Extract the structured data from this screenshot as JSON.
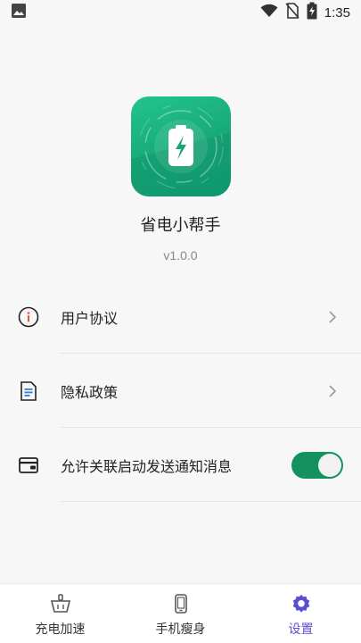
{
  "status_bar": {
    "time": "1:35",
    "icons": [
      "image-icon",
      "wifi-icon",
      "no-sim-icon",
      "battery-charging-icon"
    ]
  },
  "app": {
    "name": "省电小帮手",
    "version": "v1.0.0",
    "icon": "battery-bolt-icon"
  },
  "settings": {
    "items": [
      {
        "label": "用户协议",
        "icon": "info-circle-icon",
        "type": "link"
      },
      {
        "label": "隐私政策",
        "icon": "document-icon",
        "type": "link"
      },
      {
        "label": "允许关联启动发送通知消息",
        "icon": "wallet-icon",
        "type": "toggle",
        "enabled": true
      }
    ]
  },
  "bottom_nav": {
    "items": [
      {
        "label": "充电加速",
        "icon": "basket-icon",
        "active": false
      },
      {
        "label": "手机瘦身",
        "icon": "phone-icon",
        "active": false
      },
      {
        "label": "设置",
        "icon": "gear-icon",
        "active": true
      }
    ]
  },
  "colors": {
    "accent_green": "#13925f",
    "accent_purple": "#5b4fd0",
    "icon_gradient_top": "#22c48e",
    "icon_gradient_bottom": "#0f9a70"
  }
}
